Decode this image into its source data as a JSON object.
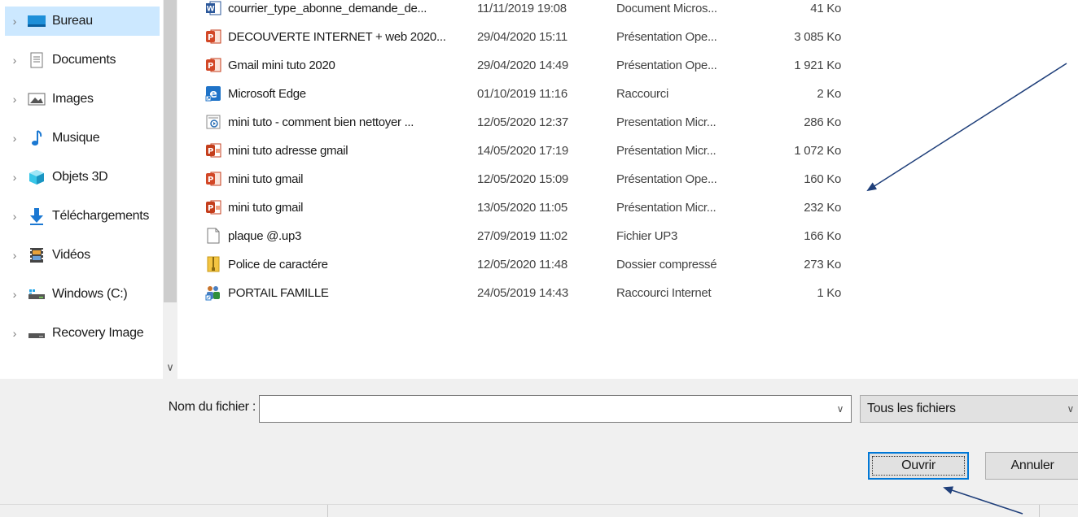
{
  "nav": {
    "items": [
      {
        "label": "Bureau",
        "icon": "desktop-icon",
        "selected": true
      },
      {
        "label": "Documents",
        "icon": "documents-icon"
      },
      {
        "label": "Images",
        "icon": "pictures-icon"
      },
      {
        "label": "Musique",
        "icon": "music-icon"
      },
      {
        "label": "Objets 3D",
        "icon": "3d-objects-icon"
      },
      {
        "label": "Téléchargements",
        "icon": "downloads-icon"
      },
      {
        "label": "Vidéos",
        "icon": "videos-icon"
      },
      {
        "label": "Windows (C:)",
        "icon": "drive-icon"
      },
      {
        "label": "Recovery Image",
        "icon": "drive-icon"
      }
    ]
  },
  "files": [
    {
      "name": "courrier_type_abonne_demande_de...",
      "date": "11/11/2019 19:08",
      "type": "Document Micros...",
      "size": "41 Ko",
      "icon": "word-icon"
    },
    {
      "name": "DECOUVERTE INTERNET + web 2020...",
      "date": "29/04/2020 15:11",
      "type": "Présentation Ope...",
      "size": "3 085 Ko",
      "icon": "powerpoint-icon"
    },
    {
      "name": "Gmail mini tuto 2020",
      "date": "29/04/2020 14:49",
      "type": "Présentation Ope...",
      "size": "1 921 Ko",
      "icon": "powerpoint-icon"
    },
    {
      "name": "Microsoft Edge",
      "date": "01/10/2019 11:16",
      "type": "Raccourci",
      "size": "2 Ko",
      "icon": "edge-icon"
    },
    {
      "name": "mini tuto - comment bien nettoyer ...",
      "date": "12/05/2020 12:37",
      "type": "Presentation Micr...",
      "size": "286 Ko",
      "icon": "slideshow-icon"
    },
    {
      "name": "mini tuto adresse gmail",
      "date": "14/05/2020 17:19",
      "type": "Présentation Micr...",
      "size": "1 072 Ko",
      "icon": "pptx-icon"
    },
    {
      "name": "mini tuto gmail",
      "date": "12/05/2020 15:09",
      "type": "Présentation Ope...",
      "size": "160 Ko",
      "icon": "powerpoint-icon"
    },
    {
      "name": "mini tuto gmail",
      "date": "13/05/2020 11:05",
      "type": "Présentation Micr...",
      "size": "232 Ko",
      "icon": "pptx-icon"
    },
    {
      "name": "plaque @.up3",
      "date": "27/09/2019 11:02",
      "type": "Fichier UP3",
      "size": "166 Ko",
      "icon": "blank-file-icon"
    },
    {
      "name": "Police de caractére",
      "date": "12/05/2020 11:48",
      "type": "Dossier compressé",
      "size": "273 Ko",
      "icon": "zip-folder-icon"
    },
    {
      "name": "PORTAIL FAMILLE",
      "date": "24/05/2019 14:43",
      "type": "Raccourci Internet",
      "size": "1 Ko",
      "icon": "internet-shortcut-icon"
    }
  ],
  "filename": {
    "label": "Nom du fichier :",
    "value": ""
  },
  "filter": {
    "selected": "Tous les fichiers"
  },
  "buttons": {
    "open": "Ouvrir",
    "cancel": "Annuler"
  },
  "colors": {
    "selection": "#cce8ff",
    "accent": "#0078d7",
    "arrow": "#1f3f7a"
  }
}
